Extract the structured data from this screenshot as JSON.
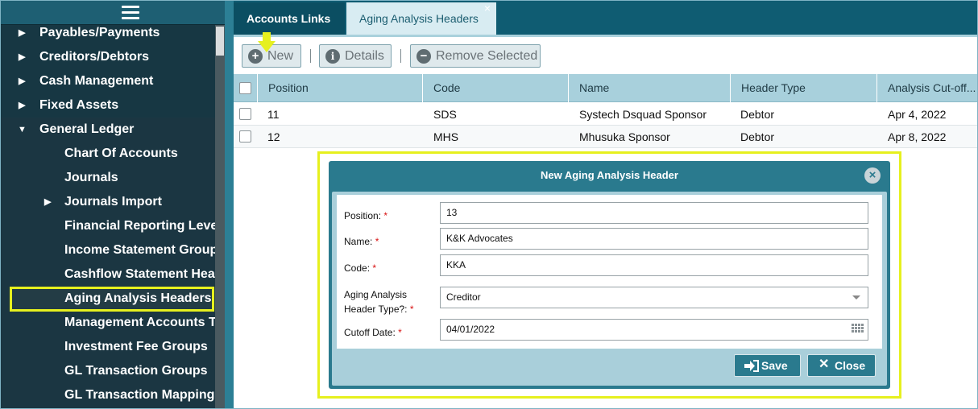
{
  "sidebar": {
    "items": [
      {
        "label": "Payables/Payments"
      },
      {
        "label": "Creditors/Debtors"
      },
      {
        "label": "Cash Management"
      },
      {
        "label": "Fixed Assets"
      },
      {
        "label": "General Ledger"
      },
      {
        "label": "Chart Of Accounts"
      },
      {
        "label": "Journals"
      },
      {
        "label": "Journals Import"
      },
      {
        "label": "Financial Reporting Levels"
      },
      {
        "label": "Income Statement Groups"
      },
      {
        "label": "Cashflow Statement Hea..."
      },
      {
        "label": "Aging Analysis Headers"
      },
      {
        "label": "Management Accounts T..."
      },
      {
        "label": "Investment Fee Groups"
      },
      {
        "label": "GL Transaction Groups"
      },
      {
        "label": "GL Transaction Mappings"
      }
    ]
  },
  "tabs": [
    {
      "label": "Accounts Links"
    },
    {
      "label": "Aging Analysis Headers",
      "close": "×"
    }
  ],
  "toolbar": {
    "new_label": "New",
    "details_label": "Details",
    "remove_label": "Remove Selected"
  },
  "grid": {
    "columns": [
      "Position",
      "Code",
      "Name",
      "Header Type",
      "Analysis Cut-off..."
    ],
    "rows": [
      {
        "position": "11",
        "code": "SDS",
        "name": "Systech Dsquad Sponsor",
        "type": "Debtor",
        "cutoff": "Apr 4, 2022"
      },
      {
        "position": "12",
        "code": "MHS",
        "name": "Mhusuka Sponsor",
        "type": "Debtor",
        "cutoff": "Apr 8, 2022"
      }
    ]
  },
  "dialog": {
    "title": "New Aging Analysis Header",
    "required_mark": "*",
    "fields": {
      "position": {
        "label": "Position:",
        "value": "13"
      },
      "name": {
        "label": "Name:",
        "value": "K&K Advocates"
      },
      "code": {
        "label": "Code:",
        "value": "KKA"
      },
      "header_type": {
        "label_line1": "Aging Analysis",
        "label_line2": "Header Type?:",
        "value": "Creditor"
      },
      "cutoff": {
        "label": "Cutoff Date:",
        "value": "04/01/2022"
      }
    },
    "save_label": "Save",
    "close_label": "Close"
  },
  "colors": {
    "sidebar_bg": "#173743",
    "accent": "#2a7a8e",
    "highlight": "#e6f01e",
    "required": "#d81010"
  }
}
